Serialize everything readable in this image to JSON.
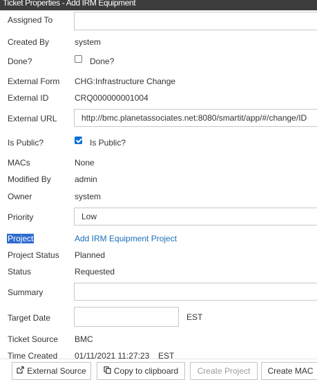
{
  "window": {
    "title": "Ticket Properties - Add IRM Equipment"
  },
  "fields": {
    "assigned_to": {
      "label": "Assigned To",
      "value": ""
    },
    "created_by": {
      "label": "Created By",
      "value": "system"
    },
    "done": {
      "label": "Done?",
      "checkbox_label": "Done?",
      "checked": false
    },
    "external_form": {
      "label": "External Form",
      "value": "CHG:Infrastructure Change"
    },
    "external_id": {
      "label": "External ID",
      "value": "CRQ000000001004"
    },
    "external_url": {
      "label": "External URL",
      "value": "http://bmc.planetassociates.net:8080/smartit/app/#/change/ID"
    },
    "is_public": {
      "label": "Is Public?",
      "checkbox_label": "Is Public?",
      "checked": true
    },
    "macs": {
      "label": "MACs",
      "value": "None"
    },
    "modified_by": {
      "label": "Modified By",
      "value": "admin"
    },
    "owner": {
      "label": "Owner",
      "value": "system"
    },
    "priority": {
      "label": "Priority",
      "value": "Low"
    },
    "project": {
      "label": "Project",
      "value": "Add IRM Equipment Project"
    },
    "project_status": {
      "label": "Project Status",
      "value": "Planned"
    },
    "status": {
      "label": "Status",
      "value": "Requested"
    },
    "summary": {
      "label": "Summary",
      "value": ""
    },
    "target_date": {
      "label": "Target Date",
      "value": "",
      "timezone": "EST"
    },
    "ticket_source": {
      "label": "Ticket Source",
      "value": "BMC"
    },
    "time_created": {
      "label": "Time Created",
      "value": "01/11/2021 11:27:23",
      "timezone": "EST"
    }
  },
  "footer": {
    "external_source": "External Source",
    "copy_to_clipboard": "Copy to clipboard",
    "create_project": "Create Project",
    "create_mac": "Create MAC"
  },
  "colors": {
    "titlebar": "#3d3d3d",
    "link": "#1a6fb5",
    "checkbox": "#0b6fd8",
    "selection": "#2f6bd0"
  }
}
